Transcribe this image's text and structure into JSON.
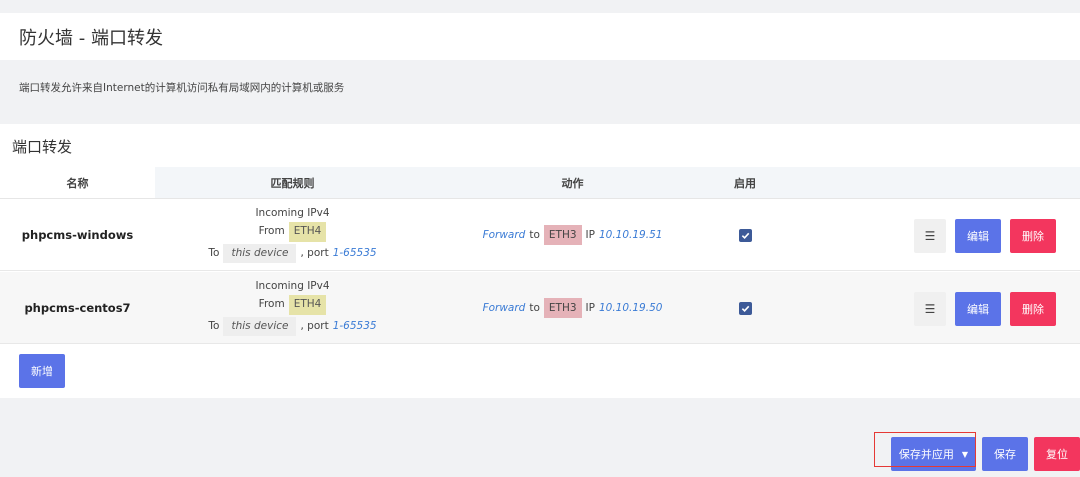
{
  "page": {
    "title": "防火墙 - 端口转发",
    "description": "端口转发允许来自Internet的计算机访问私有局域网内的计算机或服务"
  },
  "section": {
    "title": "端口转发",
    "columns": {
      "name": "名称",
      "match": "匹配规则",
      "action": "动作",
      "enable": "启用"
    }
  },
  "rows": [
    {
      "name": "phpcms-windows",
      "incoming": "Incoming IPv4",
      "from_label": "From",
      "from_zone": "ETH4",
      "to_label": "To",
      "to_target": "this device",
      "port_label": ", port",
      "port_value": "1-65535",
      "action_verb": "Forward",
      "action_to": "to",
      "dest_zone": "ETH3",
      "ip_label": "IP",
      "ip_value": "10.10.19.51",
      "enabled": true,
      "menu_label": "☰",
      "edit_label": "编辑",
      "delete_label": "删除"
    },
    {
      "name": "phpcms-centos7",
      "incoming": "Incoming IPv4",
      "from_label": "From",
      "from_zone": "ETH4",
      "to_label": "To",
      "to_target": "this device",
      "port_label": ", port",
      "port_value": "1-65535",
      "action_verb": "Forward",
      "action_to": "to",
      "dest_zone": "ETH3",
      "ip_label": "IP",
      "ip_value": "10.10.19.50",
      "enabled": true,
      "menu_label": "☰",
      "edit_label": "编辑",
      "delete_label": "删除"
    }
  ],
  "buttons": {
    "add": "新增",
    "save_apply": "保存并应用",
    "save_apply_caret": "▼",
    "save": "保存",
    "reset": "复位"
  },
  "colors": {
    "primary": "#5b73e8",
    "danger": "#f3365e",
    "zone_eth4": "#e6e3a8",
    "zone_eth3": "#e5b2b8",
    "highlight_outline": "#e53935"
  }
}
